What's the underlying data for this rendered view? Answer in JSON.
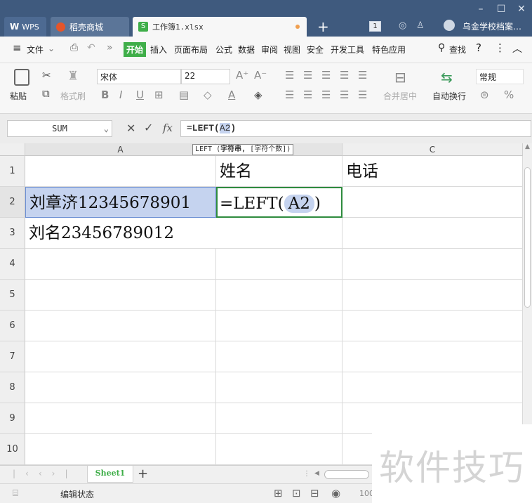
{
  "tabs": [
    {
      "label": "WPS",
      "icon": "wps-logo-icon"
    },
    {
      "label": "稻壳商城",
      "icon": "docer-icon"
    },
    {
      "label": "工作簿1.xlsx",
      "icon": "spreadsheet-icon"
    }
  ],
  "title_badge": "1",
  "user_name": "乌金学校档案…",
  "menu": {
    "file": "文件",
    "items": [
      "开始",
      "插入",
      "页面布局",
      "公式",
      "数据",
      "审阅",
      "视图",
      "安全",
      "开发工具",
      "特色应用"
    ],
    "search": "查找"
  },
  "ribbon": {
    "paste": "粘贴",
    "format_painter": "格式刷",
    "font": "宋体",
    "size": "22",
    "merge": "合并居中",
    "wrap": "自动换行",
    "number_format": "常规"
  },
  "formula_bar": {
    "name_box": "SUM",
    "fx": "fx",
    "formula": "=LEFT(A2)",
    "formula_prefix": "=LEFT(",
    "formula_ref": "A2",
    "formula_suffix": ")"
  },
  "tooltip": {
    "fn": "LEFT",
    "args": "(字符串, [字符个数])",
    "args_bold": "字符串,",
    "args_rest": "[字符个数])"
  },
  "columns": [
    "A",
    "B",
    "C"
  ],
  "rows": [
    "1",
    "2",
    "3",
    "4",
    "5",
    "6",
    "7",
    "8",
    "9",
    "10"
  ],
  "cells": {
    "B1": "姓名",
    "C1": "电话",
    "A2": "刘章济12345678901",
    "B2_prefix": "=LEFT(",
    "B2_ref": "A2",
    "B2_suffix": ")",
    "A3": "刘名23456789012"
  },
  "sheet_tab": "Sheet1",
  "status": "编辑状态",
  "zoom": "100",
  "watermark": "软件技巧",
  "colors": {
    "titlebar": "#3f5a7e",
    "accent_green": "#3fae49",
    "selection_green": "#2e8b3e",
    "ref_highlight": "#c5d3ef"
  }
}
